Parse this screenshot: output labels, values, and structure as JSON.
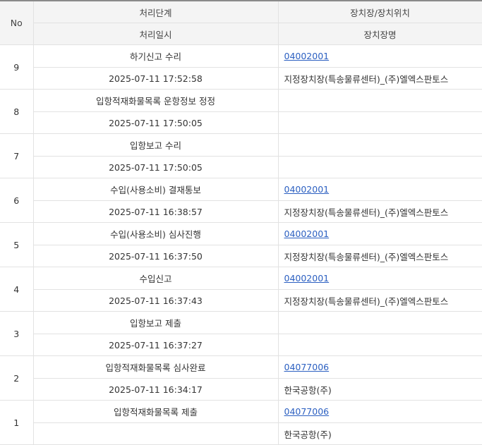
{
  "header": {
    "no": "No",
    "stage": "처리단계",
    "location": "장치장/장치위치",
    "datetime": "처리일시",
    "location_name": "장치장명"
  },
  "rows": [
    {
      "no": "9",
      "stage": "하기신고 수리",
      "datetime": "2025-07-11 17:52:58",
      "code": "04002001",
      "name": "지정장치장(특송물류센터)_(주)엘엑스판토스"
    },
    {
      "no": "8",
      "stage": "입항적재화물목록 운항정보 정정",
      "datetime": "2025-07-11 17:50:05",
      "code": "",
      "name": ""
    },
    {
      "no": "7",
      "stage": "입항보고 수리",
      "datetime": "2025-07-11 17:50:05",
      "code": "",
      "name": ""
    },
    {
      "no": "6",
      "stage": "수입(사용소비) 결재통보",
      "datetime": "2025-07-11 16:38:57",
      "code": "04002001",
      "name": "지정장치장(특송물류센터)_(주)엘엑스판토스"
    },
    {
      "no": "5",
      "stage": "수입(사용소비) 심사진행",
      "datetime": "2025-07-11 16:37:50",
      "code": "04002001",
      "name": "지정장치장(특송물류센터)_(주)엘엑스판토스"
    },
    {
      "no": "4",
      "stage": "수입신고",
      "datetime": "2025-07-11 16:37:43",
      "code": "04002001",
      "name": "지정장치장(특송물류센터)_(주)엘엑스판토스"
    },
    {
      "no": "3",
      "stage": "입항보고 제출",
      "datetime": "2025-07-11 16:37:27",
      "code": "",
      "name": ""
    },
    {
      "no": "2",
      "stage": "입항적재화물목록 심사완료",
      "datetime": "2025-07-11 16:34:17",
      "code": "04077006",
      "name": "한국공항(주)"
    },
    {
      "no": "1",
      "stage": "입항적재화물목록 제출",
      "datetime": "",
      "code": "04077006",
      "name": "한국공항(주)"
    }
  ]
}
